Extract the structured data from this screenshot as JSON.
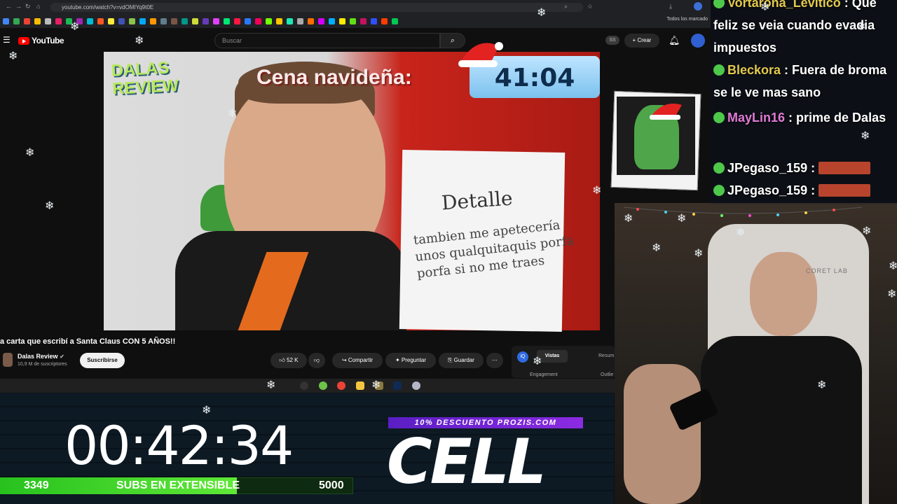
{
  "browser": {
    "url": "youtube.com/watch?v=vdOMIYq9t0E",
    "bookmarks_all": "Todos los marcado",
    "bookmark_colors": [
      "#4285f4",
      "#34a853",
      "#ea4335",
      "#fbbc05",
      "#bbb",
      "#e91e63",
      "#1db954",
      "#9c27b0",
      "#00bcd4",
      "#ff5722",
      "#ffeb3b",
      "#3f51b5",
      "#8bc34a",
      "#03a9f4",
      "#ff9800",
      "#607d8b",
      "#795548",
      "#009688",
      "#cddc39",
      "#673ab7",
      "#e040fb",
      "#00e676",
      "#ff1744",
      "#2979ff",
      "#f50057",
      "#76ff03",
      "#ffc400",
      "#1de9b6",
      "#aaa",
      "#ff6d00",
      "#d500f9",
      "#00b0ff",
      "#ffea00",
      "#64dd17",
      "#c51162",
      "#304ffe",
      "#ff3d00",
      "#00c853"
    ]
  },
  "youtube": {
    "logo": "YouTube",
    "search_placeholder": "Buscar",
    "create_label": "Crear",
    "ss_badge": "SS",
    "video": {
      "title": "a carta que escribí a Santa Claus CON 5 AÑOS!!",
      "channel": "Dalas Review",
      "subscribers": "10,9 M de suscriptores",
      "subscribe_label": "Suscribirse",
      "likes": "52 K",
      "share_label": "Compartir",
      "ask_label": "Preguntar",
      "save_label": "Guardar"
    },
    "panel": {
      "tab1": "Vistas",
      "tab2": "Resum",
      "row1": "Engagement",
      "row2": "Outlie"
    }
  },
  "video_frame": {
    "logo_line1": "DALAS",
    "logo_line2": "REVIEW",
    "cena_label": "Cena navideña:",
    "cena_timer": "41:04",
    "letter_title": "Detalle",
    "letter_body": "tambien me apetecería unos qualquitaquis porfa porfa si no me traes"
  },
  "overlay": {
    "countdown": "00:42:34",
    "subs_current": "3349",
    "subs_label": "SUBS EN EXTENSIBLE",
    "subs_goal": "5000",
    "subs_progress": 0.67,
    "promo": "10% DESCUENTO PROZIS.COM",
    "brand": "CELL"
  },
  "chat": [
    {
      "user": "Vortarona_Levitico",
      "msg": "Que feliz se veia cuando evadia impuestos",
      "color": "#e3c94e"
    },
    {
      "user": "Bleckora",
      "msg": "Fuera de broma se le ve mas sano",
      "color": "#e3c94e"
    },
    {
      "user": "MayLin16",
      "msg": "prime de Dalas",
      "color": "#e07ad6"
    },
    {
      "user": "JPegaso_159",
      "msg": "",
      "color": "#ffffff"
    },
    {
      "user": "JPegaso_159",
      "msg": "",
      "color": "#ffffff"
    }
  ],
  "webcam": {
    "chair_brand": "CORET LAB"
  }
}
